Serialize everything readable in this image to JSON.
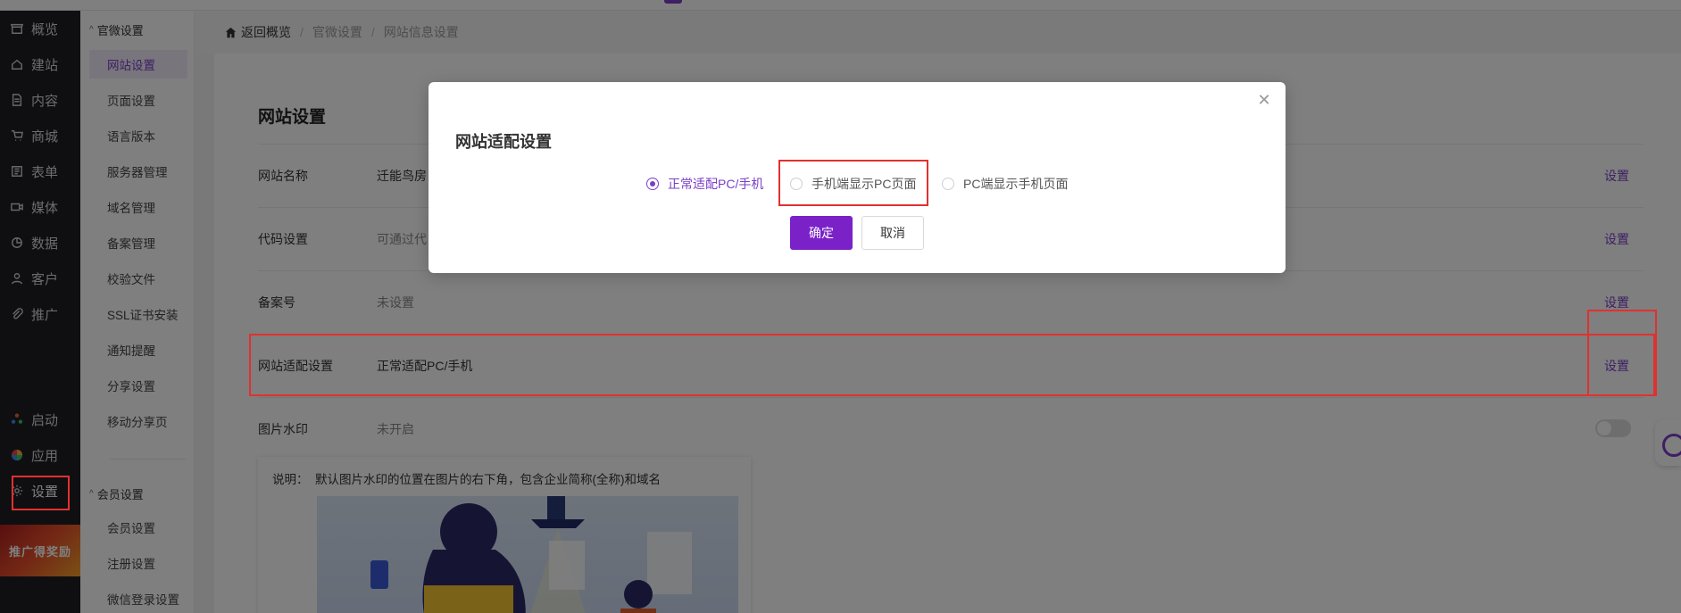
{
  "sidebar": {
    "items": [
      {
        "label": "概览",
        "icon": "store-icon"
      },
      {
        "label": "建站",
        "icon": "home-icon"
      },
      {
        "label": "内容",
        "icon": "document-icon"
      },
      {
        "label": "商城",
        "icon": "cart-icon"
      },
      {
        "label": "表单",
        "icon": "form-icon"
      },
      {
        "label": "媒体",
        "icon": "video-icon"
      },
      {
        "label": "数据",
        "icon": "chart-icon"
      },
      {
        "label": "客户",
        "icon": "user-icon"
      },
      {
        "label": "推广",
        "icon": "paperclip-icon"
      }
    ],
    "bottom_items": [
      {
        "label": "启动",
        "icon": "launch-icon"
      },
      {
        "label": "应用",
        "icon": "apps-icon"
      },
      {
        "label": "设置",
        "icon": "gear-icon"
      }
    ],
    "promo_label": "推广得奖励"
  },
  "submenu": {
    "group1": "官微设置",
    "items": [
      "网站设置",
      "页面设置",
      "语言版本",
      "服务器管理",
      "域名管理",
      "备案管理",
      "校验文件",
      "SSL证书安装",
      "通知提醒",
      "分享设置",
      "移动分享页"
    ],
    "group2": "会员设置",
    "items2": [
      "会员设置",
      "注册设置",
      "微信登录设置"
    ]
  },
  "breadcrumb": {
    "home": "返回概览",
    "level1": "官微设置",
    "level2": "网站信息设置"
  },
  "panel": {
    "title": "网站设置",
    "rows": [
      {
        "label": "网站名称",
        "value": "迁能鸟房",
        "action": "设置"
      },
      {
        "label": "代码设置",
        "value": "可通过代",
        "action": "设置"
      },
      {
        "label": "备案号",
        "value": "未设置",
        "action": "设置"
      },
      {
        "label": "网站适配设置",
        "value": "正常适配PC/手机",
        "action": "设置"
      },
      {
        "label": "图片水印",
        "value": "未开启"
      }
    ],
    "note_label": "说明：",
    "note_text": "默认图片水印的位置在图片的右下角，包含企业简称(全称)和域名"
  },
  "modal": {
    "title": "网站适配设置",
    "options": [
      "正常适配PC/手机",
      "手机端显示PC页面",
      "PC端显示手机页面"
    ],
    "selected": "正常适配PC/手机",
    "confirm": "确定",
    "cancel": "取消"
  },
  "colors": {
    "accent": "#7a3fc9",
    "highlight": "#e0312f"
  }
}
